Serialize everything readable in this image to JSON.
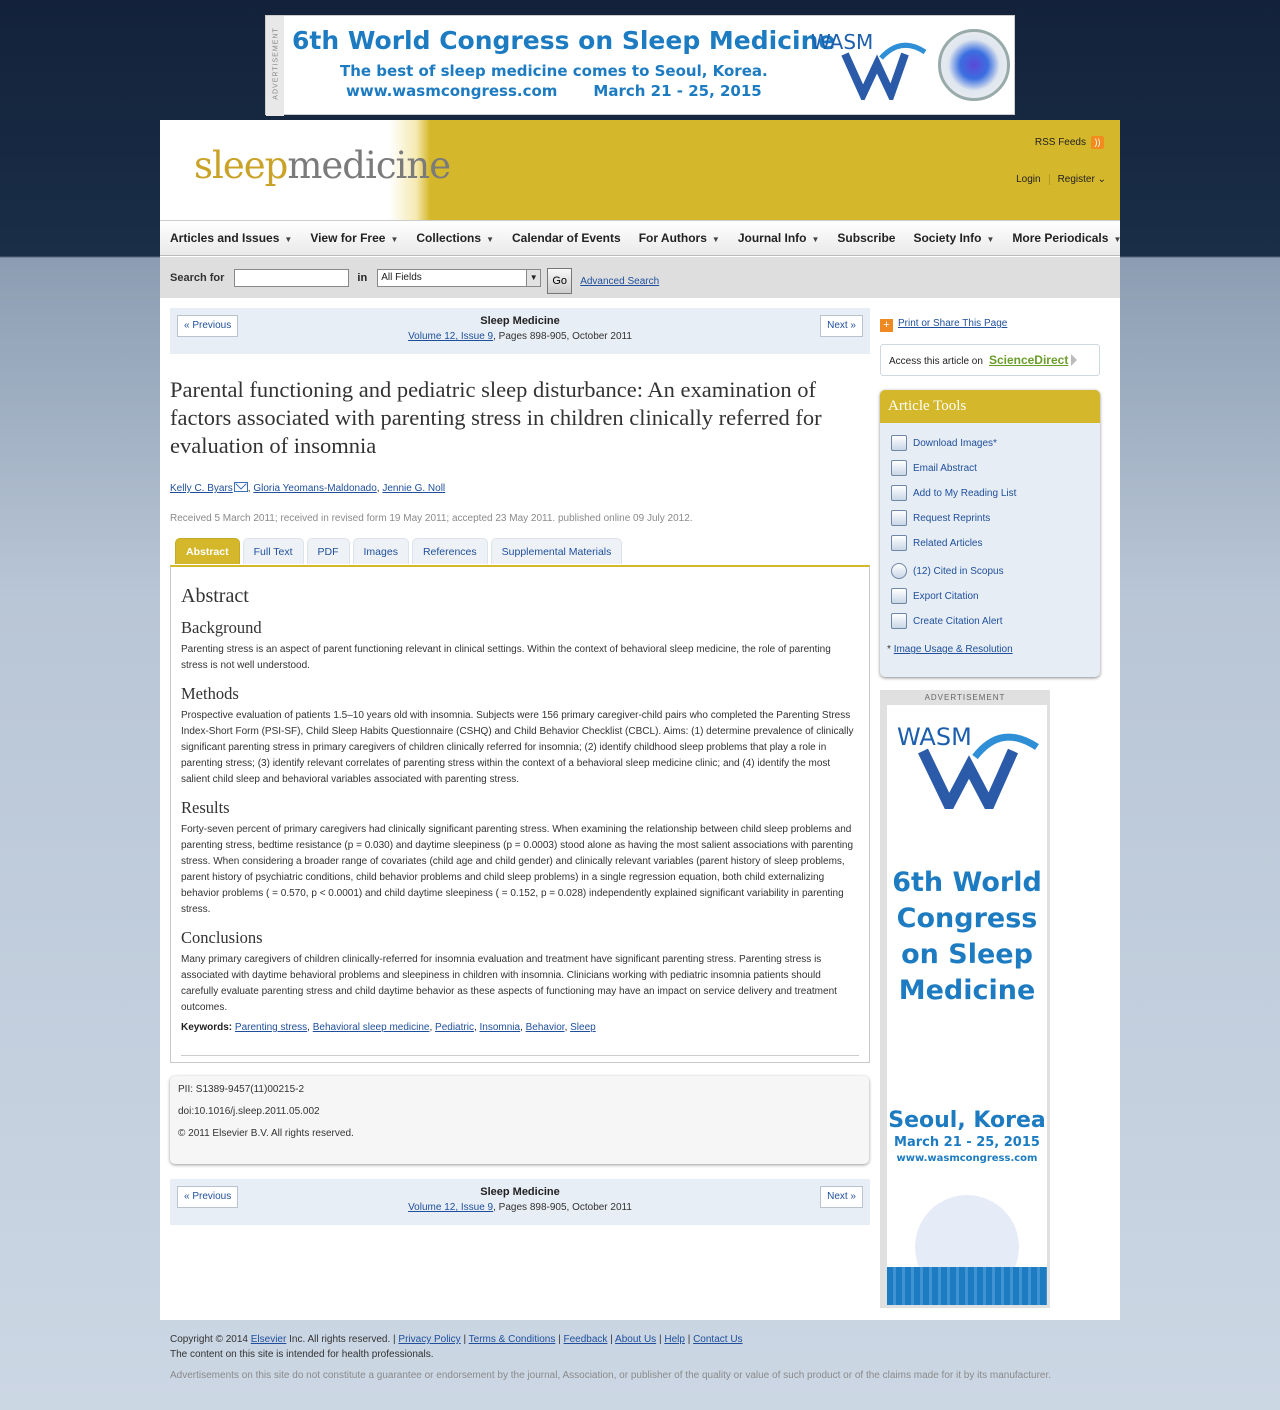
{
  "top_ad": {
    "label": "ADVERTISEMENT",
    "headline": "6th World Congress on Sleep Medicine",
    "tagline": "The best of sleep medicine comes to Seoul, Korea.",
    "url": "www.wasmcongress.com",
    "dates": "March 21 - 25, 2015",
    "brand": "WASM"
  },
  "header": {
    "logo_sleep": "sleep",
    "logo_medicine": "medicine",
    "rss": "RSS Feeds",
    "login": "Login",
    "register": "Register"
  },
  "nav": [
    "Articles and Issues",
    "View for Free",
    "Collections",
    "Calendar of Events",
    "For Authors",
    "Journal Info",
    "Subscribe",
    "Society Info",
    "More Periodicals"
  ],
  "search": {
    "label": "Search for",
    "in": "in",
    "field": "All Fields",
    "go": "Go",
    "advanced": "Advanced Search"
  },
  "article_nav": {
    "prev": "« Previous",
    "next": "Next »",
    "journal": "Sleep Medicine",
    "volume": "Volume 12, Issue 9",
    "pages": ", Pages 898-905, October 2011"
  },
  "article": {
    "title": "Parental functioning and pediatric sleep disturbance: An examination of factors associated with parenting stress in children clinically referred for evaluation of insomnia",
    "authors": [
      "Kelly C. Byars",
      "Gloria Yeomans-Maldonado",
      "Jennie G. Noll"
    ],
    "dates": "Received 5 March 2011; received in revised form 19 May 2011; accepted 23 May 2011. published online 09 July 2012.",
    "tabs": [
      "Abstract",
      "Full Text",
      "PDF",
      "Images",
      "References",
      "Supplemental Materials"
    ],
    "abstract_heading": "Abstract",
    "sections": [
      {
        "heading": "Background",
        "text": "Parenting stress is an aspect of parent functioning relevant in clinical settings. Within the context of behavioral sleep medicine, the role of parenting stress is not well understood."
      },
      {
        "heading": "Methods",
        "text": "Prospective evaluation of patients 1.5–10 years old with insomnia. Subjects were 156 primary caregiver-child pairs who completed the Parenting Stress Index-Short Form (PSI-SF), Child Sleep Habits Questionnaire (CSHQ) and Child Behavior Checklist (CBCL). Aims: (1) determine prevalence of clinically significant parenting stress in primary caregivers of children clinically referred for insomnia; (2) identify childhood sleep problems that play a role in parenting stress; (3) identify relevant correlates of parenting stress within the context of a behavioral sleep medicine clinic; and (4) identify the most salient child sleep and behavioral variables associated with parenting stress."
      },
      {
        "heading": "Results",
        "text": "Forty-seven percent of primary caregivers had clinically significant parenting stress. When examining the relationship between child sleep problems and parenting stress, bedtime resistance (p = 0.030) and daytime sleepiness (p = 0.0003) stood alone as having the most salient associations with parenting stress. When considering a broader range of covariates (child age and child gender) and clinically relevant variables (parent history of sleep problems, parent history of psychiatric conditions, child behavior problems and child sleep problems) in a single regression equation, both child externalizing behavior problems ( = 0.570, p < 0.0001) and child daytime sleepiness ( = 0.152, p = 0.028) independently explained significant variability in parenting stress."
      },
      {
        "heading": "Conclusions",
        "text": "Many primary caregivers of children clinically-referred for insomnia evaluation and treatment have significant parenting stress. Parenting stress is associated with daytime behavioral problems and sleepiness in children with insomnia. Clinicians working with pediatric insomnia patients should carefully evaluate parenting stress and child daytime behavior as these aspects of functioning may have an impact on service delivery and treatment outcomes."
      }
    ],
    "keywords_label": "Keywords:",
    "keywords": [
      "Parenting stress",
      "Behavioral sleep medicine",
      "Pediatric",
      "Insomnia",
      "Behavior",
      "Sleep"
    ],
    "pii": "PII: S1389-9457(11)00215-2",
    "doi": "doi:10.1016/j.sleep.2011.05.002",
    "copyright": "© 2011 Elsevier B.V. All rights reserved."
  },
  "sidebar": {
    "share": "Print or Share This Page",
    "access_prefix": "Access this article on",
    "access_link": "ScienceDirect",
    "tools_title": "Article Tools",
    "tools": [
      {
        "label": "Download Images*",
        "icon": "download-images-icon"
      },
      {
        "label": "Email Abstract",
        "icon": "email-icon"
      },
      {
        "label": "Add to My Reading List",
        "icon": "reading-list-icon"
      },
      {
        "label": "Request Reprints",
        "icon": "reprints-icon"
      },
      {
        "label": "Related Articles",
        "icon": "related-articles-icon"
      },
      {
        "label": "(12) Cited in Scopus",
        "icon": "scopus-icon"
      },
      {
        "label": "Export Citation",
        "icon": "export-citation-icon"
      },
      {
        "label": "Create Citation Alert",
        "icon": "citation-alert-icon"
      }
    ],
    "note_star": "*",
    "note_link": "Image Usage & Resolution",
    "ad": {
      "label": "ADVERTISEMENT",
      "brand": "WASM",
      "headline": "6th World Congress on Sleep Medicine",
      "city": "Seoul, Korea",
      "dates": "March 21 - 25, 2015",
      "url": "www.wasmcongress.com"
    }
  },
  "footer": {
    "copyright": "Copyright © 2014",
    "elsevier": "Elsevier",
    "rights": "Inc. All rights reserved.",
    "links": [
      "Privacy Policy",
      "Terms & Conditions",
      "Feedback",
      "About Us",
      "Help",
      "Contact Us"
    ],
    "intended": "The content on this site is intended for health professionals.",
    "disclaimer": "Advertisements on this site do not constitute a guarantee or endorsement by the journal, Association, or publisher of the quality or value of such product or of the claims made for it by its manufacturer."
  }
}
